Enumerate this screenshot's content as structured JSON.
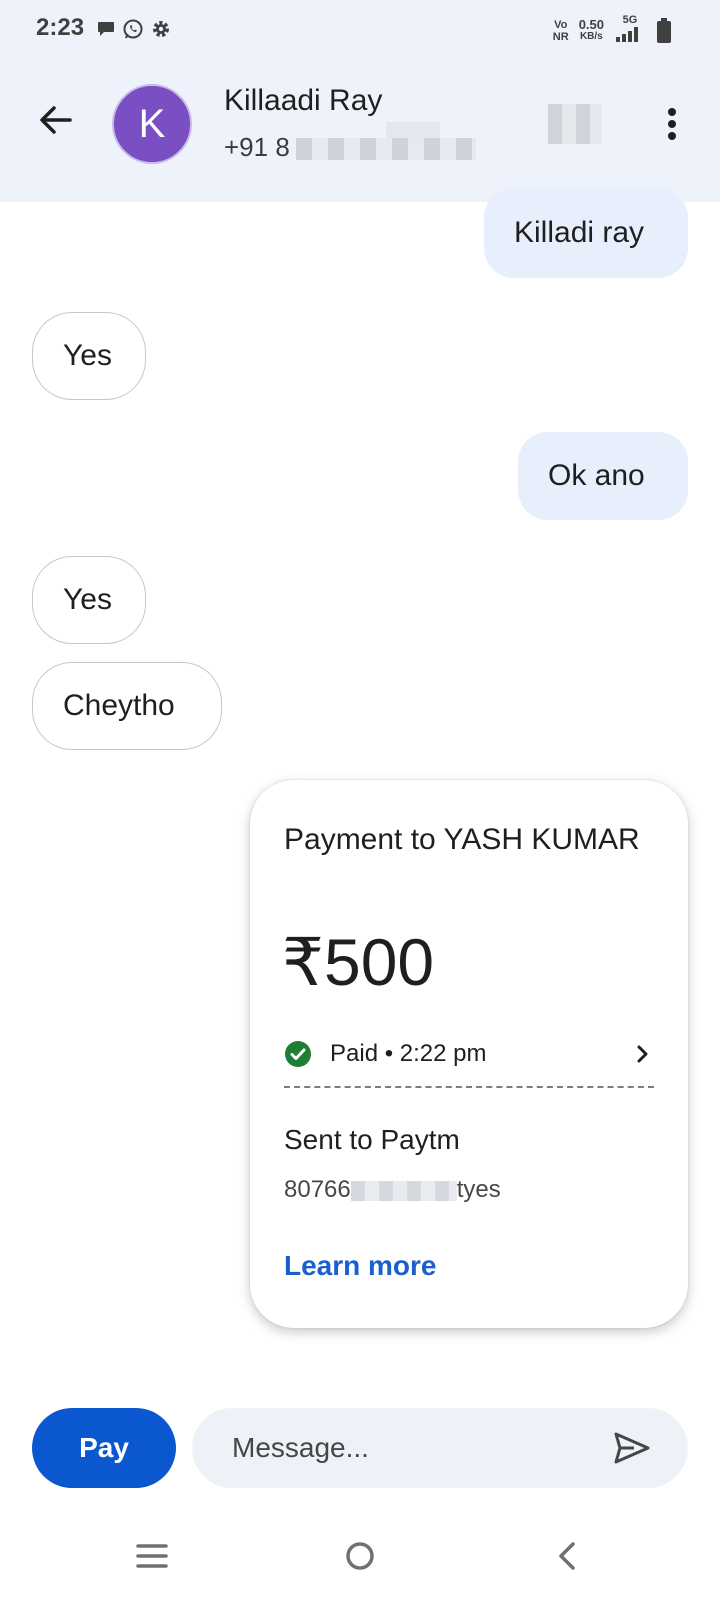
{
  "status_bar": {
    "time": "2:23",
    "left_icons": [
      "message-icon",
      "whatsapp-icon",
      "gear-icon"
    ],
    "network_top": "Vo",
    "network_bottom": "NR",
    "speed_value": "0.50",
    "speed_unit": "KB/s",
    "network_type": "5G",
    "right_icons": [
      "signal-icon",
      "battery-icon"
    ]
  },
  "header": {
    "contact_initial": "K",
    "contact_name": "Killaadi Ray",
    "contact_phone_visible": "+91 8",
    "avatar_color": "#7a4fc3",
    "icons": [
      "back-arrow-icon",
      "call-icon",
      "more-vertical-icon"
    ]
  },
  "messages": [
    {
      "direction": "outgoing",
      "text": "Killadi ray"
    },
    {
      "direction": "incoming",
      "text": "Yes"
    },
    {
      "direction": "outgoing",
      "text": "Ok ano"
    },
    {
      "direction": "incoming",
      "text": "Yes"
    },
    {
      "direction": "incoming",
      "text": "Cheytho"
    }
  ],
  "payment_card": {
    "title": "Payment to YASH KUMAR",
    "amount": "₹500",
    "status": "Paid • 2:22 pm",
    "sent_to": "Sent to Paytm",
    "account_prefix": "80766",
    "account_suffix": "tyes",
    "learn_more": "Learn more",
    "status_color": "#1e7e34",
    "link_color": "#1a5fd0"
  },
  "composer": {
    "pay_label": "Pay",
    "message_placeholder": "Message...",
    "pay_color": "#0b57d0"
  },
  "nav_bar": {
    "icons": [
      "menu-icon",
      "home-icon",
      "back-icon"
    ]
  }
}
